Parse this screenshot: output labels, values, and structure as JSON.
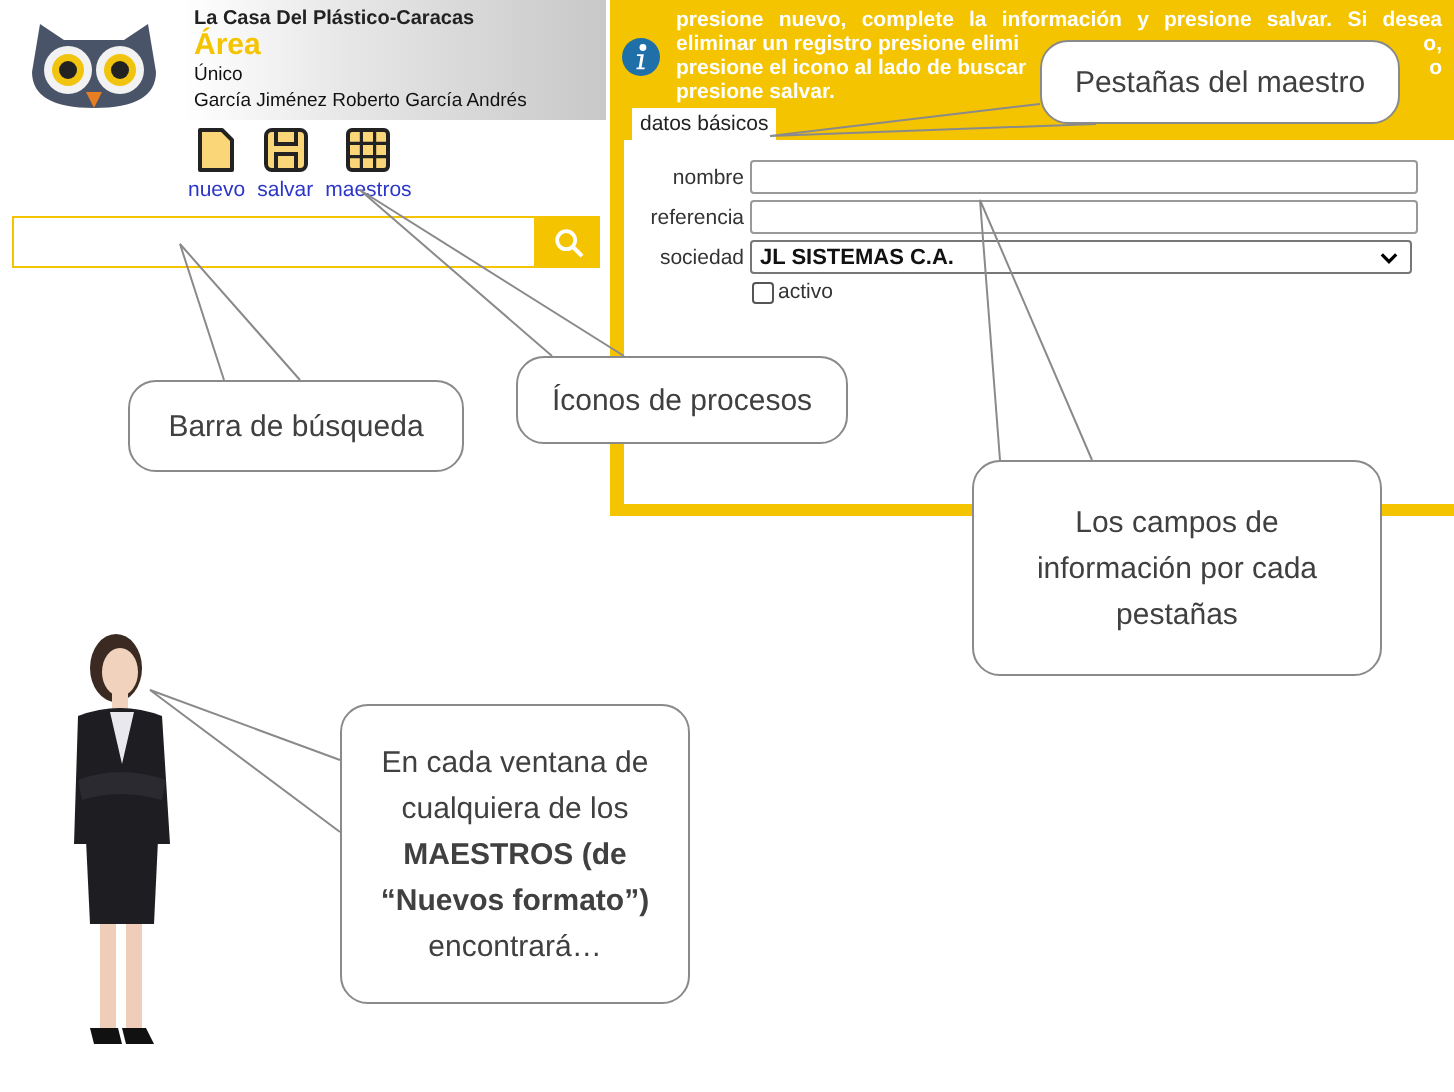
{
  "header": {
    "company": "La Casa Del Plástico-Caracas",
    "title": "Área",
    "subtitle": "Único",
    "user": "García Jiménez Roberto García Andrés"
  },
  "toolbar": [
    {
      "kind": "new",
      "label": "nuevo"
    },
    {
      "kind": "save",
      "label": "salvar"
    },
    {
      "kind": "grid",
      "label": "maestros"
    }
  ],
  "info": {
    "lines": [
      {
        "left": "presione nuevo, complete la información y presione salvar. Si desea"
      },
      {
        "left": "eliminar un registro presione elimi",
        "right": "o,"
      },
      {
        "left": "presione el icono al lado de buscar",
        "right": "o"
      },
      {
        "left": "presione salvar."
      }
    ]
  },
  "tabs": [
    {
      "label": "datos básicos",
      "selected": true
    }
  ],
  "form": {
    "fields": [
      {
        "kind": "text",
        "label": "nombre"
      },
      {
        "kind": "text",
        "label": "referencia"
      },
      {
        "kind": "select",
        "label": "sociedad",
        "value": "JL SISTEMAS C.A."
      },
      {
        "kind": "checkbox",
        "label": "activo",
        "checked": false
      }
    ]
  },
  "callouts": [
    {
      "text": "Pestañas del maestro"
    },
    {
      "text": "Barra de búsqueda"
    },
    {
      "text": "Íconos de procesos"
    },
    {
      "text": "Los campos de información por cada pestañas"
    },
    {
      "text": "En cada ventana de cualquiera de los **MAESTROS (de “Nuevos formato”)** encontrará…"
    }
  ]
}
